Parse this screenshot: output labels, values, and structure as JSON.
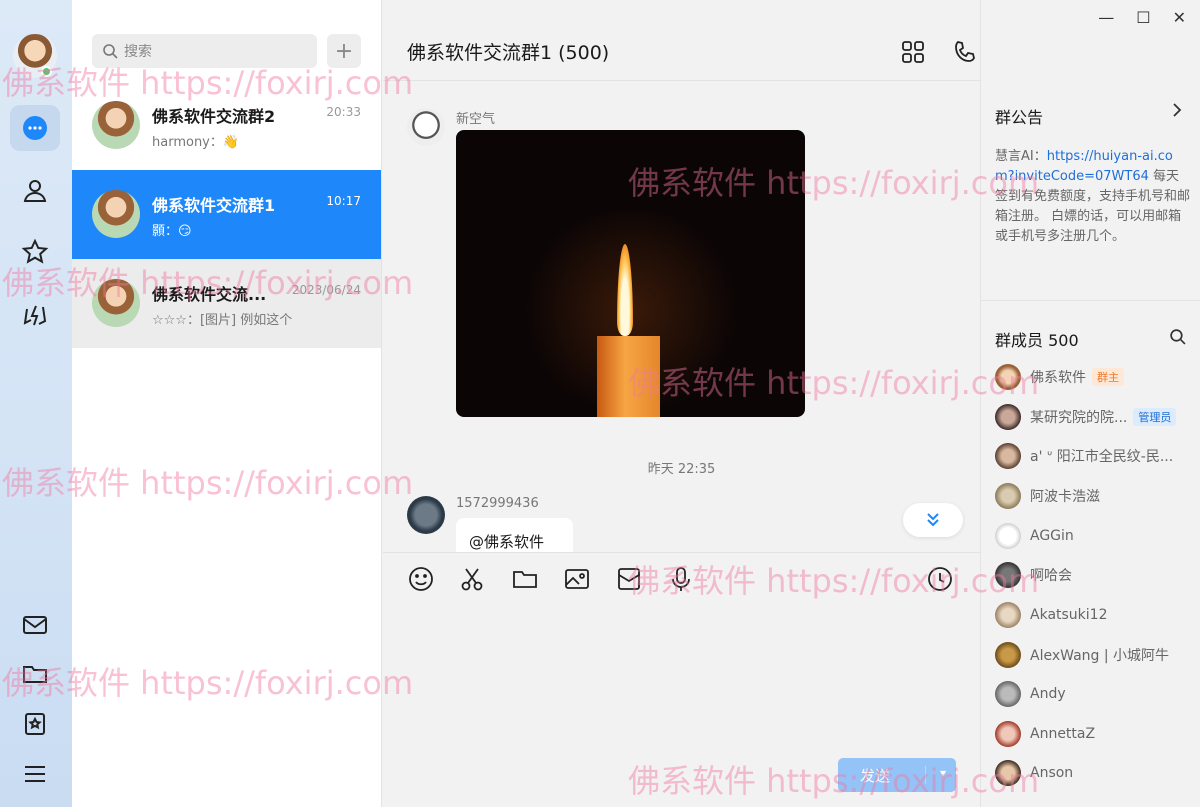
{
  "rail": {
    "colors": {
      "accent": "#1e87fa",
      "online": "#3ed06a"
    },
    "icons": [
      "chat-icon",
      "contacts-icon",
      "star-icon",
      "lightning-icon",
      "mail-icon",
      "folder-icon",
      "bookmark-icon",
      "menu-icon"
    ]
  },
  "list": {
    "search_placeholder": "搜索",
    "add_label": "+",
    "conversations": [
      {
        "name": "佛系软件交流群2",
        "time": "20:33",
        "preview": "harmony：👋"
      },
      {
        "name": "佛系软件交流群1",
        "time": "10:17",
        "preview": "顥：😏"
      },
      {
        "name": "佛系软件交流...",
        "time": "2023/06/24",
        "preview": "☆☆☆：[图片] 例如这个"
      }
    ]
  },
  "chat": {
    "title": "佛系软件交流群1 (500)",
    "messages": [
      {
        "sender": "新空气",
        "type": "image"
      },
      {
        "timestamp": "昨天 22:35"
      },
      {
        "sender": "1572999436",
        "text": "@佛系软件"
      }
    ],
    "send_label": "发送"
  },
  "side": {
    "notice_title": "群公告",
    "notice_prefix": "慧言AI：",
    "notice_link": "https://huiyan-ai.com?inviteCode=07WT64",
    "notice_body": "每天签到有免费额度，支持手机号和邮箱注册。 白嫖的话，可以用邮箱或手机号多注册几个。",
    "members_title": "群成员 500",
    "members": [
      {
        "name": "佛系软件",
        "tag": "群主"
      },
      {
        "name": "某研究院的院...",
        "tag": "管理员"
      },
      {
        "name": "a' ᐡ 阳江市全民纹-民...",
        "tag": ""
      },
      {
        "name": "阿波卡浩滋",
        "tag": ""
      },
      {
        "name": "AGGin",
        "tag": ""
      },
      {
        "name": "啊哈会",
        "tag": ""
      },
      {
        "name": "Akatsuki12",
        "tag": ""
      },
      {
        "name": "AlexWang | 小城阿牛",
        "tag": ""
      },
      {
        "name": "Andy",
        "tag": ""
      },
      {
        "name": "AnnettaZ",
        "tag": ""
      },
      {
        "name": "Anson",
        "tag": ""
      }
    ]
  },
  "watermark": "佛系软件 https://foxirj.com"
}
